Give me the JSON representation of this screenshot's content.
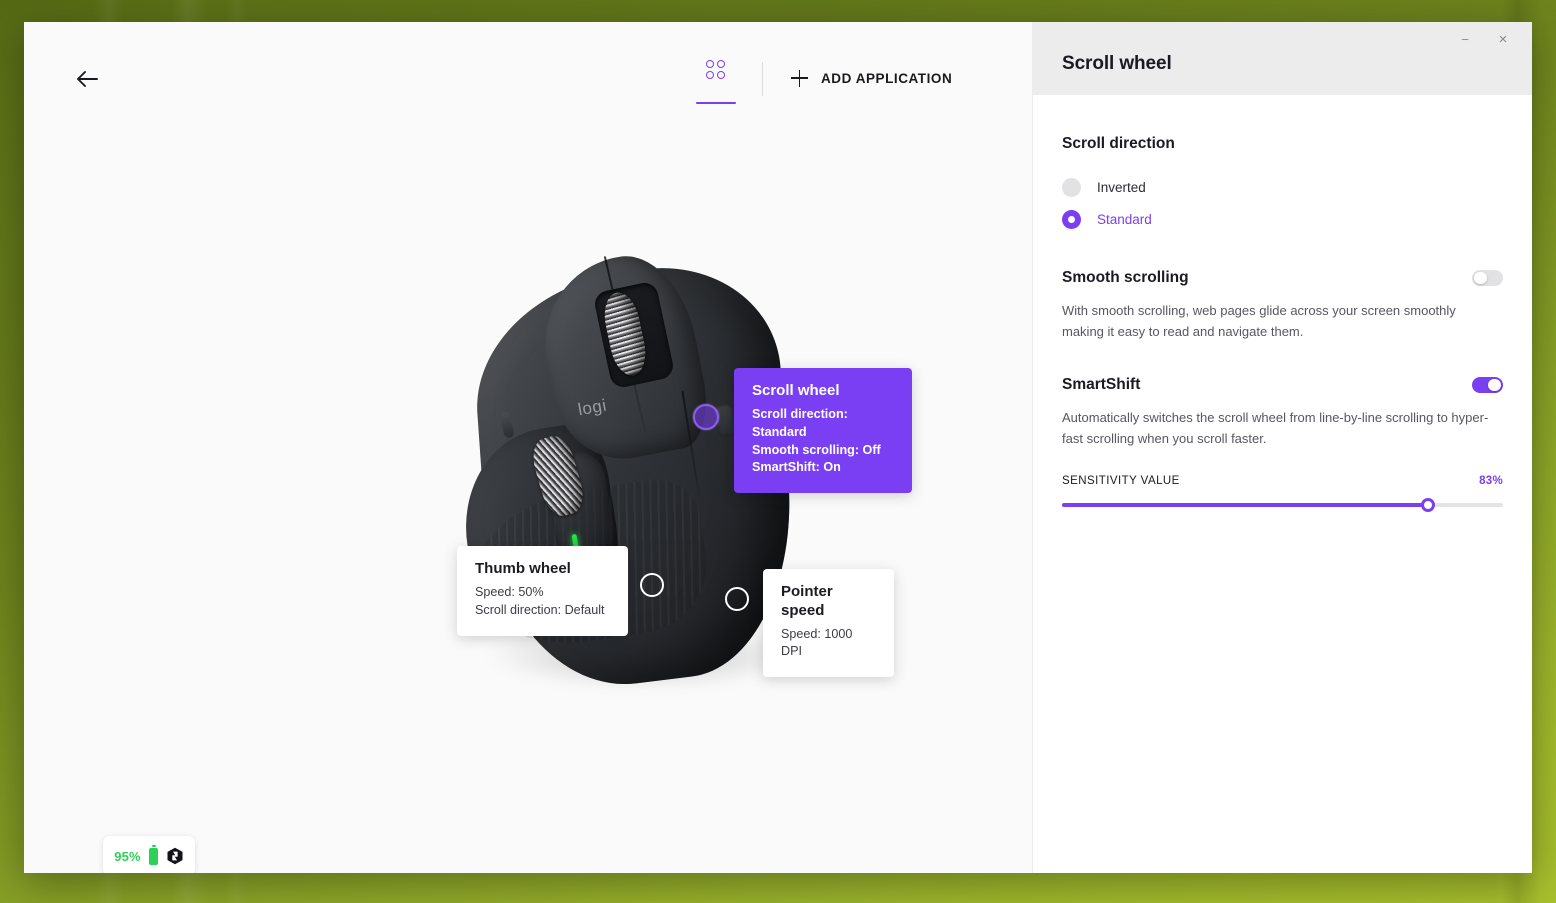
{
  "window": {
    "controls": {
      "minimize": "−",
      "close": "×"
    }
  },
  "toolbar": {
    "back_icon": "arrow-left-icon",
    "devices_tab_icon": "grid-dots-icon",
    "add_application_label": "ADD APPLICATION",
    "add_icon": "plus-icon"
  },
  "device": {
    "logo_text": "logi",
    "battery": {
      "percent": "95%",
      "battery_icon": "battery-icon",
      "flow_icon": "flow-logo-icon"
    }
  },
  "callouts": [
    {
      "id": "scroll-wheel",
      "title": "Scroll wheel",
      "lines": [
        "Scroll direction: Standard",
        "Smooth scrolling: Off",
        "SmartShift: On"
      ]
    },
    {
      "id": "thumb-wheel",
      "title": "Thumb wheel",
      "lines": [
        "Speed: 50%",
        "Scroll direction: Default"
      ]
    },
    {
      "id": "pointer-speed",
      "title": "Pointer speed",
      "lines": [
        "Speed: 1000 DPI"
      ]
    }
  ],
  "panel": {
    "title": "Scroll wheel",
    "scroll_direction": {
      "title": "Scroll direction",
      "options": [
        {
          "label": "Inverted",
          "selected": false
        },
        {
          "label": "Standard",
          "selected": true
        }
      ]
    },
    "smooth_scrolling": {
      "title": "Smooth scrolling",
      "enabled": false,
      "description": "With smooth scrolling, web pages glide across your screen smoothly making it easy to read and navigate them."
    },
    "smartshift": {
      "title": "SmartShift",
      "enabled": true,
      "description": "Automatically switches the scroll wheel from line-by-line scrolling to hyper-fast scrolling when you scroll faster.",
      "sensitivity_label": "SENSITIVITY VALUE",
      "sensitivity_value": "83%",
      "sensitivity_percent": 83
    }
  },
  "colors": {
    "accent": "#7a3ff2",
    "battery_green": "#2fd057",
    "panel_header_bg": "#ececec",
    "main_bg": "#fafafa"
  }
}
